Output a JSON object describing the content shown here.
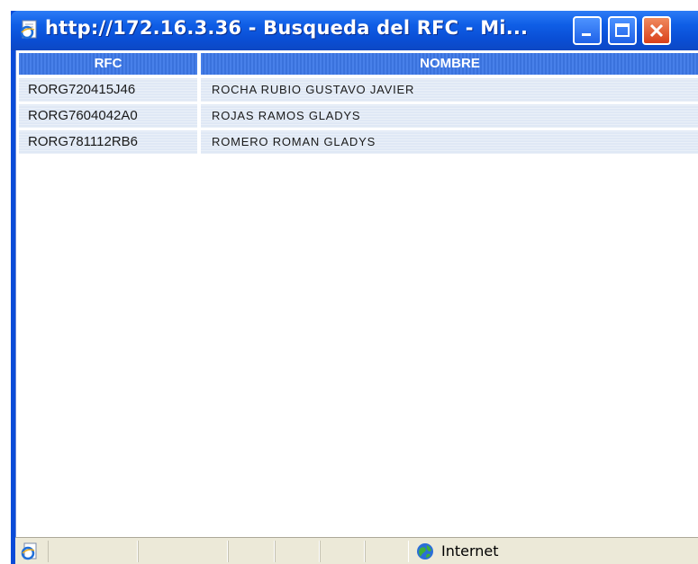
{
  "window": {
    "title": "http://172.16.3.36 - Busqueda del RFC - Mi..."
  },
  "table": {
    "columns": [
      "RFC",
      "NOMBRE"
    ],
    "rows": [
      {
        "rfc": "RORG720415J46",
        "nombre": "ROCHA RUBIO GUSTAVO JAVIER"
      },
      {
        "rfc": "RORG7604042A0",
        "nombre": "ROJAS RAMOS GLADYS"
      },
      {
        "rfc": "RORG781112RB6",
        "nombre": "ROMERO ROMAN GLADYS"
      }
    ]
  },
  "statusbar": {
    "zone_label": "Internet",
    "zone_icon": "globe-icon",
    "page_icon": "ie-page-icon"
  },
  "colors": {
    "titlebar": "#0a4fd6",
    "header": "#3d78e8",
    "row": "#dfe8f5",
    "close_button": "#d9401a"
  }
}
